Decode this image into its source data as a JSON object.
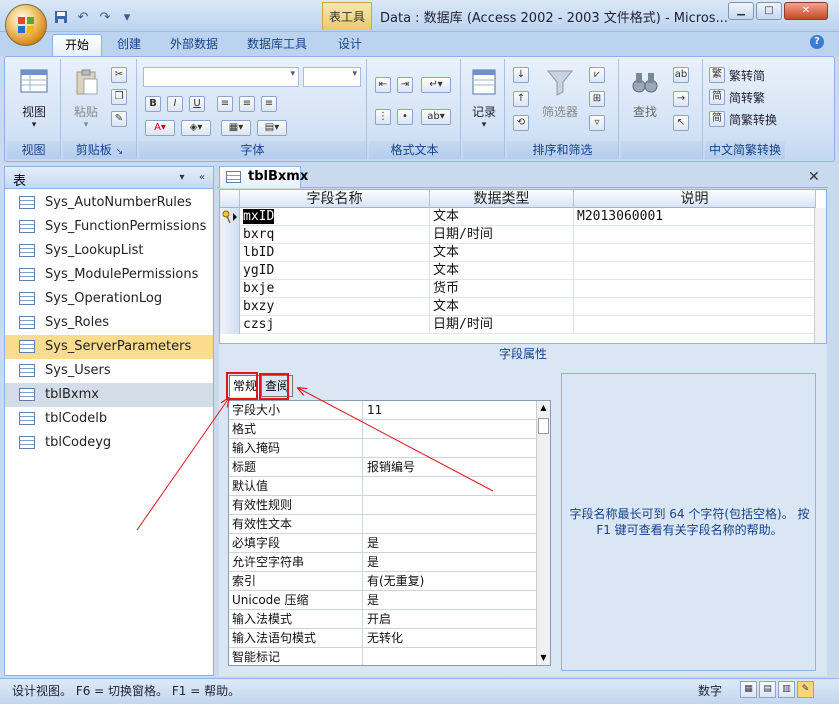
{
  "window": {
    "context_tab": "表工具",
    "title": "Data : 数据库 (Access 2002 - 2003 文件格式) - Micros...",
    "controls": [
      "minimize",
      "maximize",
      "close"
    ]
  },
  "ribbon": {
    "tabs": [
      "开始",
      "创建",
      "外部数据",
      "数据库工具",
      "设计"
    ],
    "active_tab": "开始",
    "groups": {
      "view": {
        "label": "视图",
        "button": "视图"
      },
      "clipboard": {
        "label": "剪贴板",
        "paste": "粘贴"
      },
      "font": {
        "label": "字体"
      },
      "rich_text": {
        "label": "格式文本"
      },
      "records": {
        "label": "记录",
        "button": "记录"
      },
      "sort_filter": {
        "label": "排序和筛选",
        "filter": "筛选器"
      },
      "find": {
        "label": "查找",
        "button": "查找"
      },
      "chinese": {
        "label": "中文简繁转换",
        "t2s": "繁转简",
        "s2t": "简转繁",
        "convert": "简繁转换"
      }
    }
  },
  "nav": {
    "header": "表",
    "items": [
      "Sys_AutoNumberRules",
      "Sys_FunctionPermissions",
      "Sys_LookupList",
      "Sys_ModulePermissions",
      "Sys_OperationLog",
      "Sys_Roles",
      "Sys_ServerParameters",
      "Sys_Users",
      "tblBxmx",
      "tblCodelb",
      "tblCodeyg"
    ],
    "highlighted": "Sys_ServerParameters",
    "selected": "tblBxmx"
  },
  "document": {
    "tab": "tblBxmx",
    "columns": [
      "字段名称",
      "数据类型",
      "说明"
    ],
    "rows": [
      {
        "name": "mxID",
        "type": "文本",
        "desc": "M2013060001"
      },
      {
        "name": "bxrq",
        "type": "日期/时间",
        "desc": ""
      },
      {
        "name": "lbID",
        "type": "文本",
        "desc": ""
      },
      {
        "name": "ygID",
        "type": "文本",
        "desc": ""
      },
      {
        "name": "bxje",
        "type": "货币",
        "desc": ""
      },
      {
        "name": "bxzy",
        "type": "文本",
        "desc": ""
      },
      {
        "name": "czsj",
        "type": "日期/时间",
        "desc": ""
      }
    ]
  },
  "field_properties": {
    "title": "字段属性",
    "tabs": [
      "常规",
      "查阅"
    ],
    "active_tab": "常规",
    "rows": [
      {
        "k": "字段大小",
        "v": "11"
      },
      {
        "k": "格式",
        "v": ""
      },
      {
        "k": "输入掩码",
        "v": ""
      },
      {
        "k": "标题",
        "v": "报销编号"
      },
      {
        "k": "默认值",
        "v": ""
      },
      {
        "k": "有效性规则",
        "v": ""
      },
      {
        "k": "有效性文本",
        "v": ""
      },
      {
        "k": "必填字段",
        "v": "是"
      },
      {
        "k": "允许空字符串",
        "v": "是"
      },
      {
        "k": "索引",
        "v": "有(无重复)"
      },
      {
        "k": "Unicode 压缩",
        "v": "是"
      },
      {
        "k": "输入法模式",
        "v": "开启"
      },
      {
        "k": "输入法语句模式",
        "v": "无转化"
      },
      {
        "k": "智能标记",
        "v": ""
      }
    ],
    "help": "字段名称最长可到 64 个字符(包括空格)。 按 F1 键可查看有关字段名称的帮助。"
  },
  "status": {
    "left": "设计视图。 F6 = 切换窗格。 F1 = 帮助。",
    "right": "数字"
  },
  "annotation_color": "#e0161e"
}
